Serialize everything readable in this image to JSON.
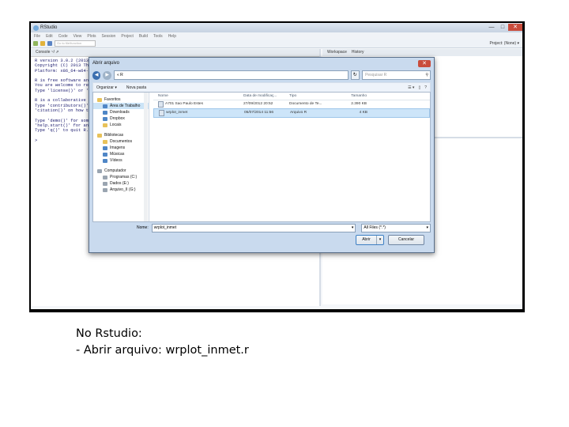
{
  "rstudio": {
    "title": "RStudio",
    "window_buttons": [
      "—",
      "□",
      "✕"
    ],
    "menu": [
      "File",
      "Edit",
      "Code",
      "View",
      "Plots",
      "Session",
      "Project",
      "Build",
      "Tools",
      "Help"
    ],
    "goto_placeholder": "Go to file/function",
    "project": "Project: (None) ▾",
    "console_tab": "Console ~/ ⇗",
    "console_text": "R version 3.0.2 (2013-09-25) -- \"Frisbee Sailing\"\nCopyright (C) 2013 The R Foundation\nPlatform: x86_64-w64-mingw32/x64\n\nR is free software and comes with\nYou are welcome to redistribute it\nType 'license()' or 'licence()' for\n\nR is a collaborative project with many\nType 'contributors()' for more\n'citation()' on how to cite R\n\nType 'demo()' for some demos, 'help()'\n'help.start()' for an HTML browser\nType 'q()' to quit R.\n\n>",
    "right_tabs": [
      "Workspace",
      "History"
    ]
  },
  "dialog": {
    "title": "Abrir arquivo",
    "close": "✕",
    "path": "« R",
    "refresh": "↻",
    "search_placeholder": "Pesquisar R",
    "search_icon": "⚲",
    "organize": "Organizar ▾",
    "new_folder": "Nova pasta",
    "view_icons": [
      "☰ ▾",
      "▯",
      "?"
    ],
    "nav": {
      "favorites": "Favoritos",
      "favorites_items": [
        "Área de Trabalho",
        "Downloads",
        "Dropbox",
        "Locais"
      ],
      "libraries": "Bibliotecas",
      "libraries_items": [
        "Documentos",
        "Imagens",
        "Músicas",
        "Vídeos"
      ],
      "computer": "Computador",
      "computer_items": [
        "Programas (C:)",
        "Dados (E:)",
        "Arquivo_II (G:)"
      ]
    },
    "columns": [
      "Nome",
      "Data de modificaç...",
      "Tipo",
      "Tamanho"
    ],
    "files": [
      {
        "name": "A701 Sao Paulo Estes",
        "date": "27/09/2012 20:52",
        "type": "Documento de Te...",
        "size": "2.390 KB"
      },
      {
        "name": "wrplot_inmet",
        "date": "05/07/2014 11:56",
        "type": "Arquivo R",
        "size": "4 KB"
      }
    ],
    "name_label": "Nome:",
    "name_value": "wrplot_inmet",
    "file_type": "All Files (*.*)",
    "open_button": "Abrir",
    "cancel_button": "Cancelar"
  },
  "caption": {
    "line1": "No Rstudio:",
    "line2": "- Abrir arquivo: wrplot_inmet.r"
  }
}
